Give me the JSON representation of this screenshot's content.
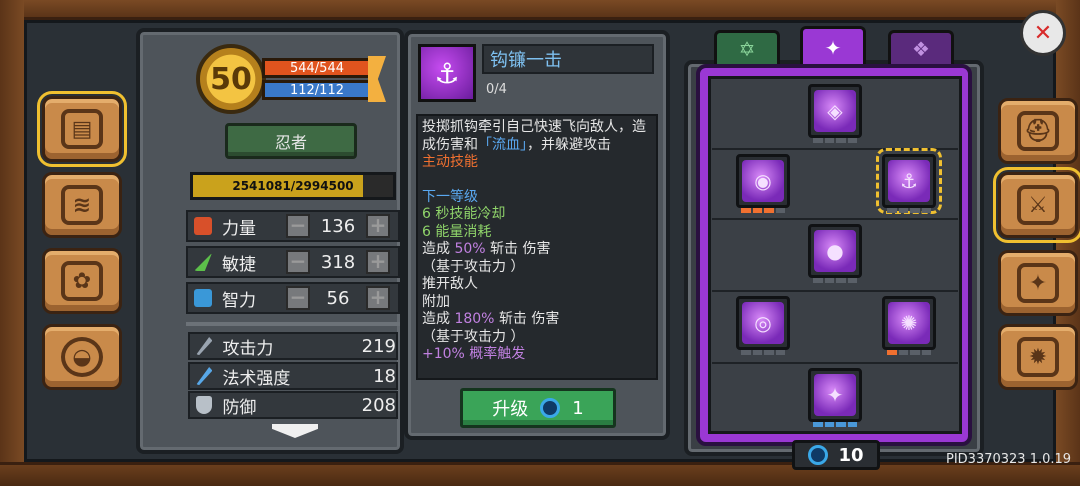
{
  "character": {
    "level": "50",
    "hp": "544/544",
    "mp": "112/112",
    "class_name": "忍者",
    "xp_text": "2541081/2994500",
    "xp_fraction": 0.849
  },
  "stats": [
    {
      "label": "力量",
      "value": "136",
      "icon": "fist-icon",
      "color": "#d8502a"
    },
    {
      "label": "敏捷",
      "value": "318",
      "icon": "feather-icon",
      "color": "#5cc04a"
    },
    {
      "label": "智力",
      "value": "56",
      "icon": "book-icon",
      "color": "#3a98d8"
    }
  ],
  "attributes": [
    {
      "label": "攻击力",
      "value": "219",
      "icon": "sword-icon"
    },
    {
      "label": "法术强度",
      "value": "18",
      "icon": "wand-icon"
    },
    {
      "label": "防御",
      "value": "208",
      "icon": "shield-icon"
    }
  ],
  "skill": {
    "name": "钩镰一击",
    "rank": "0/4",
    "desc_line1": "投掷抓钩牵引自己快速飞向敌人，造成伤害和",
    "desc_bleed": "「流血」",
    "desc_line1_end": "，并躲避攻击",
    "type": "主动技能",
    "next_title": "下一等级",
    "cooldown": "6 秒技能冷却",
    "energy": "6 能量消耗",
    "dmg1_pre": "造成",
    "dmg1_pct": "50%",
    "dmg1_post": "斩击 伤害",
    "dmg1_basis": "（基于攻击力 ）",
    "push": "推开敌人",
    "extra": "附加",
    "dmg2_pre": "造成",
    "dmg2_pct": "180%",
    "dmg2_post": "斩击 伤害",
    "dmg2_basis": "（基于攻击力 ）",
    "cut_line": "+10% 概率触发"
  },
  "upgrade": {
    "label": "升级",
    "cost": "1"
  },
  "skill_points": "10",
  "tree_tabs": [
    "star-tab",
    "shuriken-tab",
    "emblem-tab"
  ],
  "tree_nodes": [
    {
      "name": "skill-node-top",
      "icon": "ghost-icon",
      "glyph": "◈",
      "pips": "none"
    },
    {
      "name": "skill-node-shadow",
      "icon": "shadow-clones-icon",
      "glyph": "◉",
      "pips": "orange-partial"
    },
    {
      "name": "skill-node-hook",
      "icon": "grapple-hook-icon",
      "glyph": "⚓",
      "pips": "none",
      "selected": true
    },
    {
      "name": "skill-node-bomb",
      "icon": "smoke-bomb-icon",
      "glyph": "●",
      "pips": "none"
    },
    {
      "name": "skill-node-multishadow",
      "icon": "multi-shadow-icon",
      "glyph": "◎",
      "pips": "none"
    },
    {
      "name": "skill-node-cloud",
      "icon": "poison-cloud-icon",
      "glyph": "✺",
      "pips": "orange-one"
    },
    {
      "name": "skill-node-shuriken",
      "icon": "shuriken-icon",
      "glyph": "✦",
      "pips": "blue"
    }
  ],
  "side_tabs": [
    "journal-icon",
    "map-scroll-icon",
    "gear-box-icon",
    "helmet-icon"
  ],
  "right_tabs": [
    "helmet-icon",
    "crossed-swords-icon",
    "shuriken-star-icon",
    "cog-icon"
  ],
  "build_id": "PID3370323 1.0.19"
}
